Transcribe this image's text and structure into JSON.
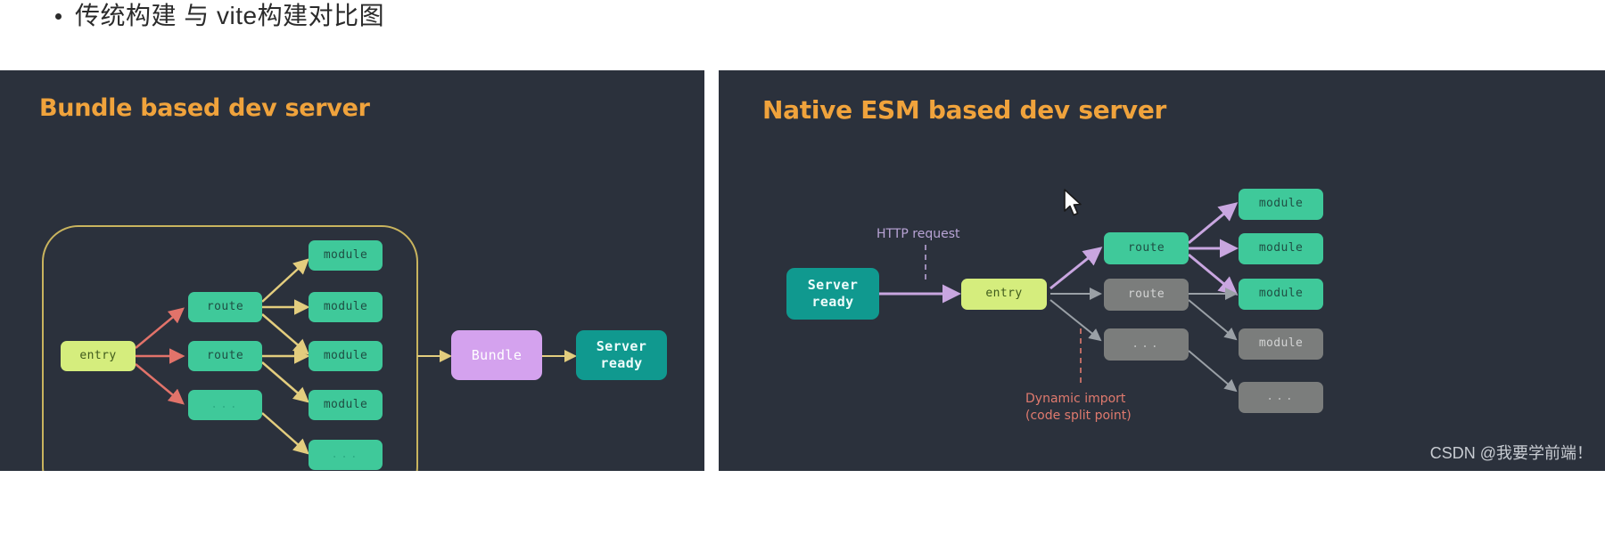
{
  "heading": {
    "bullet_text": "传统构建 与 vite构建对比图"
  },
  "colors": {
    "panel_bg": "#2b313c",
    "title_orange": "#f0a33c",
    "node_green": "#3fc99a",
    "node_lime": "#d5ed7d",
    "node_teal": "#10998f",
    "node_purple": "#d4a2ee",
    "node_gray": "#7b7d7c",
    "arrow_yellow": "#e3cd7e",
    "arrow_red": "#e2736a",
    "arrow_purple": "#c9a6e0",
    "arrow_gray": "#9aa0a6",
    "bundle_border": "#c9b45e",
    "anno_purple": "#b9a4d6",
    "anno_red": "#e07a6e"
  },
  "left_panel": {
    "title": "Bundle based dev server",
    "nodes": {
      "entry": "entry",
      "route_1": "route",
      "route_2": "route",
      "route_3": "...",
      "module_1": "module",
      "module_2": "module",
      "module_3": "module",
      "module_4": "module",
      "module_5": "...",
      "bundle": "Bundle",
      "server_ready_line1": "Server",
      "server_ready_line2": "ready"
    }
  },
  "right_panel": {
    "title": "Native ESM based dev server",
    "nodes": {
      "server_ready_line1": "Server",
      "server_ready_line2": "ready",
      "entry": "entry",
      "route_1": "route",
      "route_2": "route",
      "route_3": "...",
      "module_1": "module",
      "module_2": "module",
      "module_3": "module",
      "module_4": "module",
      "module_5": "..."
    },
    "annotations": {
      "http_request": "HTTP request",
      "dynamic_import": "Dynamic import\n(code split point)"
    }
  },
  "watermark": {
    "text": "CSDN @我要学前端！"
  }
}
